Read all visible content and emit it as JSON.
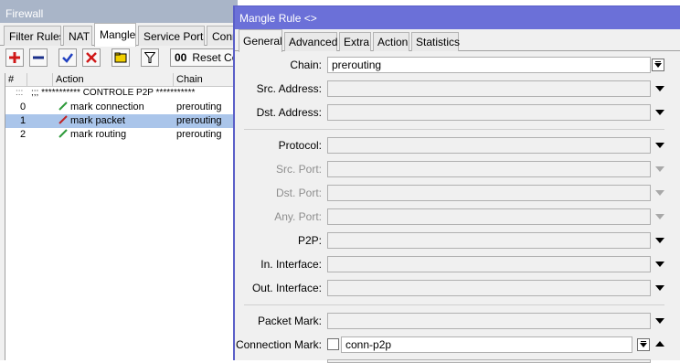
{
  "firewall": {
    "title": "Firewall",
    "tabs": [
      "Filter Rules",
      "NAT",
      "Mangle",
      "Service Ports",
      "Conn"
    ],
    "active_tab": "Mangle",
    "toolbar": {
      "reset_label": "Reset Cou",
      "reset_icon_text": "00"
    },
    "table": {
      "headers": [
        "#",
        "",
        "Action",
        "Chain"
      ],
      "comment": {
        "dots": ":::",
        "text": ";;; *********** CONTROLE P2P ***********"
      },
      "rows": [
        {
          "num": "0",
          "action": "mark connection",
          "chain": "prerouting",
          "selected": false
        },
        {
          "num": "1",
          "action": "mark packet",
          "chain": "prerouting",
          "selected": true
        },
        {
          "num": "2",
          "action": "mark routing",
          "chain": "prerouting",
          "selected": false
        }
      ]
    }
  },
  "mangle_rule": {
    "title": "Mangle Rule <>",
    "tabs": [
      "General",
      "Advanced",
      "Extra",
      "Action",
      "Statistics"
    ],
    "active_tab": "General",
    "fields": {
      "chain": {
        "label": "Chain:",
        "value": "prerouting"
      },
      "src_address": {
        "label": "Src. Address:",
        "value": ""
      },
      "dst_address": {
        "label": "Dst. Address:",
        "value": ""
      },
      "protocol": {
        "label": "Protocol:",
        "value": ""
      },
      "src_port": {
        "label": "Src. Port:",
        "value": ""
      },
      "dst_port": {
        "label": "Dst. Port:",
        "value": ""
      },
      "any_port": {
        "label": "Any. Port:",
        "value": ""
      },
      "p2p": {
        "label": "P2P:",
        "value": ""
      },
      "in_interface": {
        "label": "In. Interface:",
        "value": ""
      },
      "out_interface": {
        "label": "Out. Interface:",
        "value": ""
      },
      "packet_mark": {
        "label": "Packet Mark:",
        "value": ""
      },
      "connection_mark": {
        "label": "Connection Mark:",
        "value": "conn-p2p"
      }
    }
  },
  "colors": {
    "dialog_title_bg": "#6b70d8",
    "firewall_title_bg": "#a9b5c8",
    "selected_row": "#aac5ea",
    "add_icon": "#d01818",
    "check_icon": "#2040c0",
    "remove_x_icon": "#d01818",
    "note_icon": "#f2d000"
  }
}
